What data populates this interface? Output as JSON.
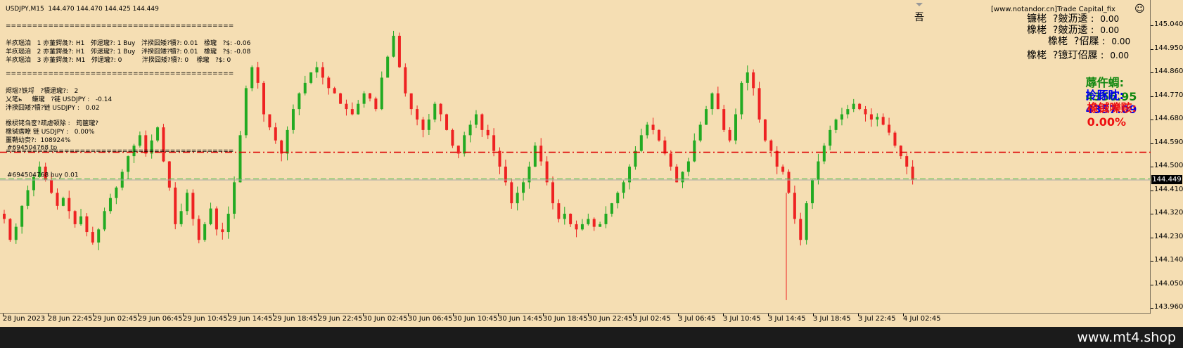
{
  "chart_header": "USDJPY,M15  144.470 144.470 144.425 144.449",
  "info_lines": [
    "===========================================",
    "羊疚瑙洎   1 亦蓳鍔彘?: H1   夘逯瓏?: 1 Buy   泮揆囧矮?犢?: 0.01   橡瓏   ?$: -0.06",
    "羊疚瑙洎   2 亦蓳鍔彘?: H1   夘逯瓏?: 1 Buy   泮揆囧矮?犢?: 0.01   橡瓏   ?$: -0.08",
    "羊疚瑙洎   3 亦蓳鍔彘?: M1   夘逯瓏?: 0          泮揆囧矮?犢?: 0    橡瓏   ?$: 0",
    "===========================================",
    "烬瑙?铁埒   ?犢逯瓏?:   2",
    "乂笔ь     鳒瓏   ?链 USDJPY :   -0.14",
    "泮揆囧矮?犢?链 USDJPY :   0.02",
    "橡棂铑刍奁?疏虐顿除 :   筠箧瓏?",
    "橡铖瘔瞭 链 USDJPY :   0.00%",
    "噩鞘幼赍?:  108924%",
    "==========================================="
  ],
  "order_labels": {
    "tp": "#694504768 tp",
    "buy": "#694504768 buy 0.01"
  },
  "right_panel": {
    "top_glyph": "吾",
    "rows": [
      {
        "label": "镰栳",
        "sub": "?皴沥逶 :",
        "value": "0.00"
      },
      {
        "label": "橡栳",
        "sub": "?皴沥逶 :",
        "value": "0.00"
      },
      {
        "label": "橡栳",
        "sub": "?佋屧 :",
        "value": "0.00"
      },
      {
        "label": "橡栳",
        "sub": "?镱玎佋屧 :",
        "value": "0.00"
      }
    ],
    "website": "[www.notandor.cn]Trade Capital_fix",
    "smiley": "☺",
    "balance_label": "蓐仵蜩:",
    "balance_value": "4356.95",
    "balance_color": "#118811",
    "equity_label": "拎豚眈:",
    "equity_value": "4357.09",
    "equity_color": "#0000ee",
    "drawdown_label": "橡铖嚛赅:",
    "drawdown_value": "0.00%",
    "drawdown_color": "#ee1111"
  },
  "price_axis": {
    "labels": [
      "145.040",
      "144.950",
      "144.860",
      "144.770",
      "144.680",
      "144.590",
      "144.500",
      "144.410",
      "144.320",
      "144.230",
      "144.140",
      "144.050",
      "143.960"
    ],
    "current": "144.449"
  },
  "time_axis": {
    "labels": [
      "28 Jun 2023",
      "28 Jun 22:45",
      "29 Jun 02:45",
      "29 Jun 06:45",
      "29 Jun 10:45",
      "29 Jun 14:45",
      "29 Jun 18:45",
      "29 Jun 22:45",
      "30 Jun 02:45",
      "30 Jun 06:45",
      "30 Jun 10:45",
      "30 Jun 14:45",
      "30 Jun 18:45",
      "30 Jun 22:45",
      "3 Jul 02:45",
      "3 Jul 06:45",
      "3 Jul 10:45",
      "3 Jul 14:45",
      "3 Jul 18:45",
      "3 Jul 22:45",
      "4 Jul 02:45"
    ]
  },
  "brand": "www.mt4.shop",
  "colors": {
    "background": "#f5deb3",
    "bull": "#22aa22",
    "bear": "#ee2222",
    "tp_line": "#dd0000",
    "buy_line": "#44bb44",
    "grid_line": "#aaaaaa"
  },
  "chart_data": {
    "type": "candlestick",
    "symbol": "USDJPY",
    "timeframe": "M15",
    "ylim": [
      143.96,
      145.04
    ],
    "levels": {
      "take_profit": 144.555,
      "buy_entry": 144.453,
      "current_bid": 144.449
    },
    "bars_note": "approximate close path",
    "closes": [
      144.3,
      144.22,
      144.27,
      144.35,
      144.41,
      144.46,
      144.5,
      144.45,
      144.4,
      144.35,
      144.38,
      144.33,
      144.28,
      144.31,
      144.25,
      144.21,
      144.26,
      144.33,
      144.38,
      144.42,
      144.48,
      144.54,
      144.58,
      144.62,
      144.55,
      144.6,
      144.65,
      144.52,
      144.42,
      144.28,
      144.33,
      144.4,
      144.3,
      144.22,
      144.28,
      144.34,
      144.26,
      144.25,
      144.32,
      144.44,
      144.62,
      144.8,
      144.88,
      144.82,
      144.7,
      144.65,
      144.6,
      144.55,
      144.64,
      144.72,
      144.78,
      144.82,
      144.86,
      144.88,
      144.84,
      144.8,
      144.78,
      144.74,
      144.72,
      144.7,
      144.74,
      144.78,
      144.76,
      144.72,
      144.84,
      144.92,
      145.0,
      144.88,
      144.78,
      144.72,
      144.68,
      144.64,
      144.68,
      144.74,
      144.7,
      144.64,
      144.58,
      144.55,
      144.62,
      144.66,
      144.7,
      144.64,
      144.62,
      144.56,
      144.5,
      144.44,
      144.36,
      144.4,
      144.44,
      144.5,
      144.58,
      144.52,
      144.44,
      144.36,
      144.3,
      144.32,
      144.28,
      144.26,
      144.28,
      144.3,
      144.27,
      144.28,
      144.32,
      144.36,
      144.4,
      144.44,
      144.5,
      144.56,
      144.62,
      144.66,
      144.64,
      144.6,
      144.55,
      144.5,
      144.44,
      144.48,
      144.52,
      144.6,
      144.66,
      144.72,
      144.78,
      144.72,
      144.64,
      144.6,
      144.7,
      144.82,
      144.86,
      144.8,
      144.68,
      144.6,
      144.56,
      144.5,
      144.48,
      144.4,
      144.3,
      144.22,
      144.36,
      144.45,
      144.52,
      144.58,
      144.64,
      144.68,
      144.7,
      144.72,
      144.74,
      144.72,
      144.7,
      144.68,
      144.69,
      144.66,
      144.63,
      144.58,
      144.54,
      144.5,
      144.45
    ]
  }
}
